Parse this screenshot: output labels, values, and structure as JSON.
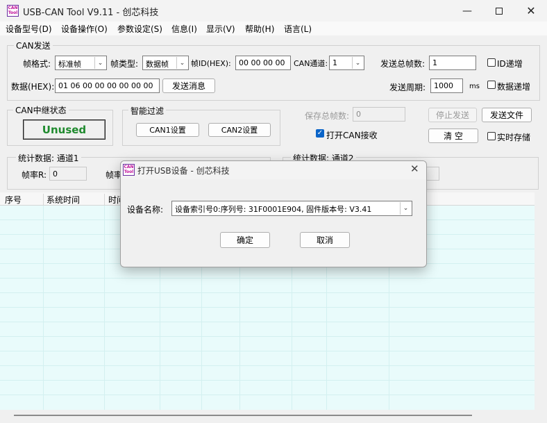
{
  "window": {
    "title": "USB-CAN Tool V9.11 - 创芯科技",
    "icon_text": "CAN Tool"
  },
  "menu": [
    "设备型号(D)",
    "设备操作(O)",
    "参数设定(S)",
    "信息(I)",
    "显示(V)",
    "帮助(H)",
    "语言(L)"
  ],
  "can_send": {
    "group_title": "CAN发送",
    "frame_format_label": "帧格式:",
    "frame_format_value": "标准帧",
    "frame_type_label": "帧类型:",
    "frame_type_value": "数据帧",
    "frame_id_label": "帧ID(HEX):",
    "frame_id_value": "00 00 00 00",
    "channel_label": "CAN通道:",
    "channel_value": "1",
    "total_frames_label": "发送总帧数:",
    "total_frames_value": "1",
    "id_increment_label": "ID递增",
    "data_label": "数据(HEX):",
    "data_value": "01 06 00 00 00 00 00 00",
    "send_button": "发送消息",
    "period_label": "发送周期:",
    "period_value": "1000",
    "period_unit": "ms",
    "data_increment_label": "数据递增"
  },
  "relay": {
    "title": "CAN中继状态",
    "status": "Unused"
  },
  "filter": {
    "title": "智能过滤",
    "can1_button": "CAN1设置",
    "can2_button": "CAN2设置"
  },
  "save": {
    "saved_frames_label": "保存总帧数:",
    "saved_frames_value": "0",
    "open_can_receive_label": "打开CAN接收",
    "stop_send_button": "停止发送",
    "send_file_button": "发送文件",
    "clear_button": "清 空",
    "realtime_save_label": "实时存储"
  },
  "stats1": {
    "title": "统计数据: 通道1",
    "rate_label": "帧率R:",
    "rate_value": "0",
    "rate2_label_partial": "帧率"
  },
  "stats2": {
    "title": "统计数据: 通道2"
  },
  "grid": {
    "columns": [
      "序号",
      "系统时间",
      "时间"
    ]
  },
  "dialog": {
    "title": "打开USB设备 - 创芯科技",
    "device_label": "设备名称:",
    "device_value": "设备索引号0:序列号: 31F0001E904, 固件版本号: V3.41",
    "ok_button": "确定",
    "cancel_button": "取消"
  },
  "colors": {
    "grid_background": "#e9fbfb",
    "unused_text": "#1f8a2e",
    "checkbox_checked": "#0a64c8"
  }
}
